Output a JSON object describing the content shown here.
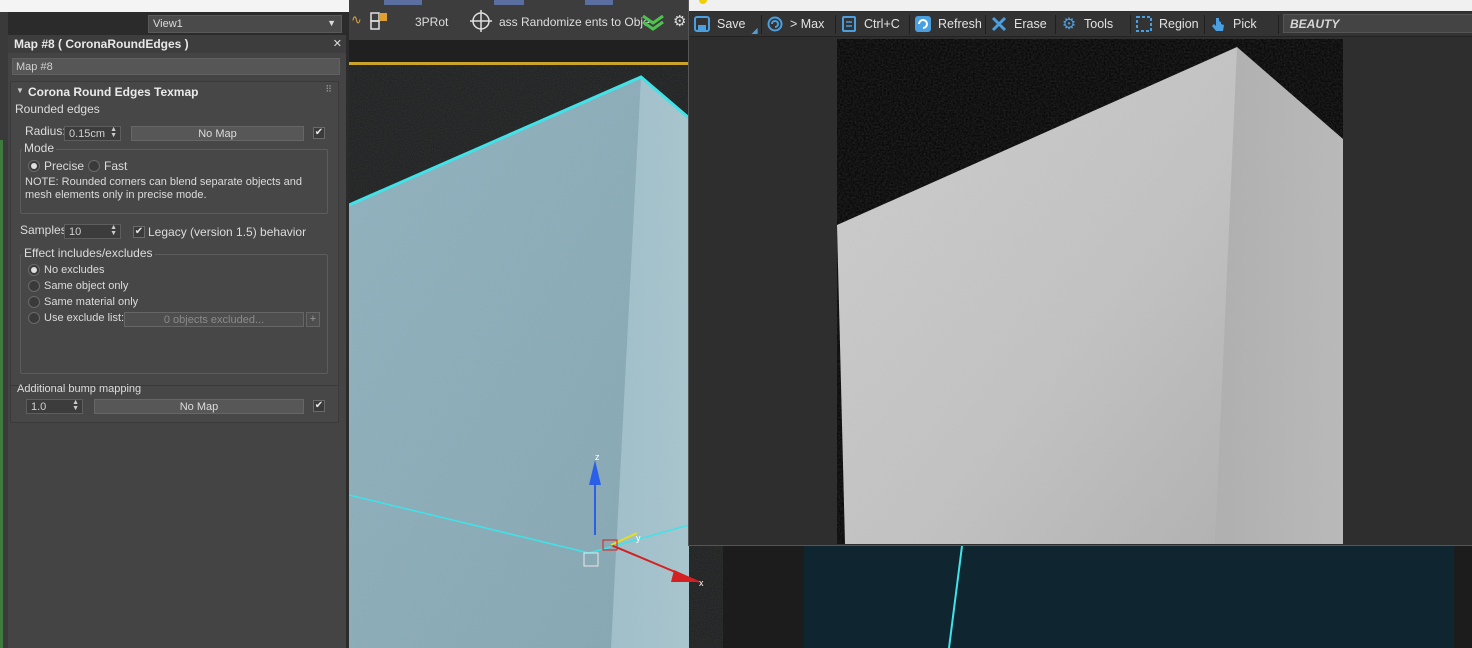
{
  "top": {
    "view_dropdown": "View1"
  },
  "material": {
    "title": "Map #8  ( CoronaRoundEdges )",
    "map_name": "Map #8",
    "rollout_title": "Corona Round Edges Texmap",
    "rounded_edges_label": "Rounded edges",
    "radius_label": "Radius:",
    "radius_value": "0.15cm",
    "radius_map": "No Map",
    "mode_label": "Mode",
    "mode_precise": "Precise",
    "mode_fast": "Fast",
    "note_line1": "NOTE: Rounded corners can blend separate objects and",
    "note_line2": "mesh elements only in precise mode.",
    "samples_label": "Samples:",
    "samples_value": "10",
    "legacy_label": "Legacy (version 1.5) behavior",
    "effect_label": "Effect includes/excludes",
    "opt_no_excludes": "No excludes",
    "opt_same_object": "Same object only",
    "opt_same_material": "Same material only",
    "opt_exclude_list": "Use exclude list:",
    "excluded_text": "0 objects excluded...",
    "plus": "+",
    "bump_label": "Additional bump mapping",
    "bump_value": "1.0",
    "bump_map": "No Map",
    "check": "✔"
  },
  "viewport_toolbar": {
    "rot_label": "3PRot",
    "randomize_label": "ass Randomize ents to Obje"
  },
  "axis": {
    "x": "x",
    "y": "y",
    "z": "z"
  },
  "vfb": {
    "save": "Save",
    "to_max": "> Max",
    "copy": "Ctrl+C",
    "refresh": "Refresh",
    "erase": "Erase",
    "tools": "Tools",
    "region": "Region",
    "pick": "Pick",
    "channel": "BEAUTY"
  },
  "colors": {
    "wireframe": "#3fe3e8",
    "accent_blue": "#4a9fe0",
    "viewport_frame": "#c9a52b"
  }
}
